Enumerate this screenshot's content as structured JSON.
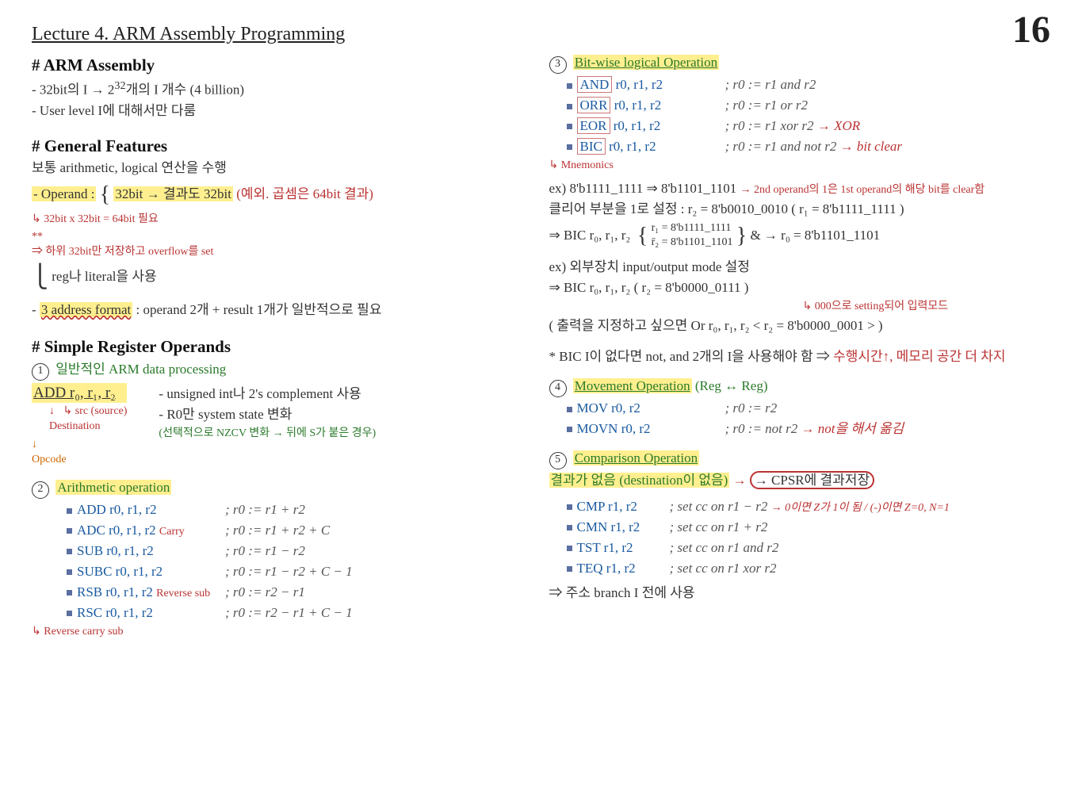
{
  "page_number": "16",
  "title": "Lecture 4. ARM Assembly Programming",
  "left": {
    "h1": "# ARM Assembly",
    "l1a": "- 32bit의 I → 2",
    "l1b": "32",
    "l1c": "개의 I 개수 (4 billion)",
    "l2": "- User level I에 대해서만 다룸",
    "h2": "# General Features",
    "gf1": "보통 arithmetic, logical 연산을 수행",
    "gf2a": "- Operand :",
    "gf2b": "32bit → 결과도 32bit",
    "gf2c": "(예외. 곱셈은 64bit 결과)",
    "gf3": "↳ 32bit x 32bit = 64bit 필요",
    "gf4": "⇒ 하위 32bit만 저장하고 overflow를 set",
    "gf5": "reg나 literal을 사용",
    "gf6a": "- ",
    "gf6b": "3 address format",
    "gf6c": " : operand 2개 + result 1개가 일반적으로 필요",
    "h3": "# Simple Register Operands",
    "sr1": "일반적인 ARM data processing",
    "add_op": "ADD r₀, r₁, r₂",
    "src_lbl": "src (source)",
    "dest_lbl": "Destination",
    "opcode_lbl": "Opcode",
    "sr2": "- unsigned int나 2's complement 사용",
    "sr3": "- R0만 system state 변화",
    "sr4": "(선택적으로 NZCV 변화 → 뒤에 S가 붙은 경우)",
    "ar_head": "Arithmetic operation",
    "ar": [
      {
        "l": "ADD r0, r1, r2",
        "r": "; r0 := r1 + r2",
        "tag": ""
      },
      {
        "l": "ADC r0, r1, r2",
        "r": "; r0 := r1 + r2 + C",
        "tag": "Carry"
      },
      {
        "l": "SUB r0, r1, r2",
        "r": "; r0 := r1 − r2",
        "tag": ""
      },
      {
        "l": "SUBC r0, r1, r2",
        "r": "; r0 := r1 − r2 + C − 1",
        "tag": ""
      },
      {
        "l": "RSB r0, r1, r2",
        "r": "; r0 := r2 − r1",
        "tag": "Reverse sub"
      },
      {
        "l": "RSC r0, r1, r2",
        "r": "; r0 := r2 − r1 + C − 1",
        "tag": ""
      }
    ],
    "rcs": "↳ Reverse carry sub"
  },
  "right": {
    "bw_head": "Bit-wise logical Operation",
    "bw": [
      {
        "m": "AND",
        "l": "r0, r1, r2",
        "r": "; r0 := r1 and r2",
        "note": ""
      },
      {
        "m": "ORR",
        "l": "r0, r1, r2",
        "r": "; r0 := r1 or r2",
        "note": ""
      },
      {
        "m": "EOR",
        "l": "r0, r1, r2",
        "r": "; r0 := r1 xor r2",
        "note": "→ XOR"
      },
      {
        "m": "BIC",
        "l": "r0, r1, r2",
        "r": "; r0 := r1 and not r2",
        "note": "→ bit clear"
      }
    ],
    "mnem": "↳ Mnemonics",
    "ex1a": "ex) 8'b1111_1111 ⇒ 8'b1101_1101",
    "ex1b": "→ 2nd operand의 1은 1st operand의 해당 bit를 clear함",
    "ex2": "클리어 부분을 1로 설정 : r₂ = 8'b0010_0010  ( r₁ = 8'b1111_1111 )",
    "ex3a": "⇒ BIC r₀, r₁, r₂",
    "ex3b": "r₁ = 8'b1111_1111",
    "ex3c": "r̄₂ = 8'b1101_1101",
    "ex3d": "& → r₀ = 8'b1101_1101",
    "ex4": "ex) 외부장치 input/output mode 설정",
    "ex5a": "⇒ BIC r₀, r₁, r₂   ( r₂ = 8'b0000_0111 )",
    "ex5b": "↳ 000으로 setting되어 입력모드",
    "ex6": "( 출력을 지정하고 싶으면   Or r₀, r₁, r₂  < r₂ = 8'b0000_0001 > )",
    "bic_note": "* BIC I이 없다면 not, and 2개의 I을 사용해야 함  ⇒",
    "bic_note2": "수행시간↑, 메모리 공간 더 차지",
    "mv_head": "Movement Operation",
    "mv_sub": "(Reg ↔ Reg)",
    "mv": [
      {
        "l": "MOV r0, r2",
        "r": "; r0 := r2",
        "note": ""
      },
      {
        "l": "MOVN r0, r2",
        "r": "; r0 := not r2",
        "note": "→ not을 해서 옮김"
      }
    ],
    "cp_head": "Comparison Operation",
    "cp_sub1": "결과가 없음 (destination이 없음)",
    "cp_sub2": "→ CPSR에 결과저장",
    "cp": [
      {
        "l": "CMP r1, r2",
        "r": "; set cc on r1 − r2",
        "note": "→ 0이면 Z가 1이 됨 / (-)이면 Z=0, N=1"
      },
      {
        "l": "CMN r1, r2",
        "r": "; set cc on r1 + r2",
        "note": ""
      },
      {
        "l": "TST r1, r2",
        "r": "; set cc on r1 and r2",
        "note": ""
      },
      {
        "l": "TEQ r1, r2",
        "r": "; set cc on r1 xor r2",
        "note": ""
      }
    ],
    "cp_foot": "⇒ 주소 branch I 전에 사용"
  }
}
